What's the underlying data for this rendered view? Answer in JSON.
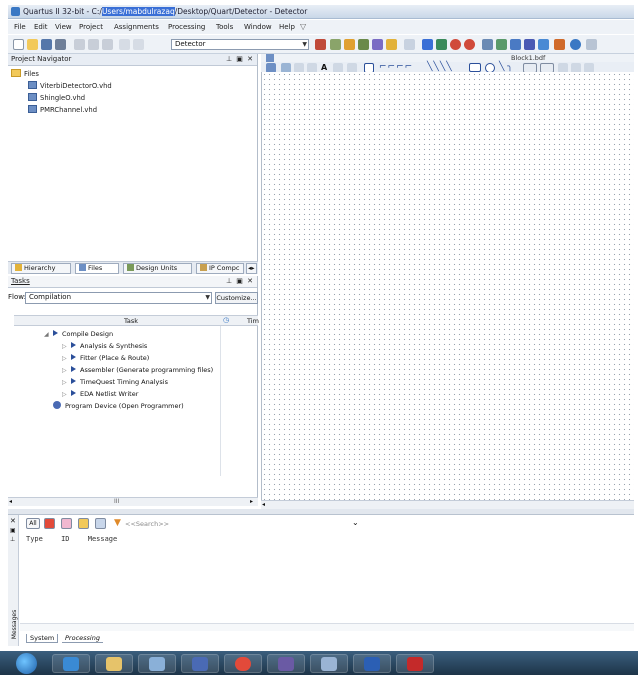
{
  "window": {
    "title_prefix": "Quartus II 32-bit - C:/",
    "title_user": "Users/mabdulrazaq",
    "title_suffix": "/Desktop/Quart/Detector - Detector"
  },
  "menu": [
    "File",
    "Edit",
    "View",
    "Project",
    "Assignments",
    "Processing",
    "Tools",
    "Window",
    "Help"
  ],
  "toolbar": {
    "entity_combo": "Detector"
  },
  "project_navigator": {
    "title": "Project Navigator",
    "root": "Files",
    "files": [
      "ViterbiDetectorO.vhd",
      "ShingleO.vhd",
      "PMRChannel.vhd"
    ],
    "tabs": [
      "Hierarchy",
      "Files",
      "Design Units",
      "IP Compc"
    ]
  },
  "document": {
    "tab_title": "Block1.bdf"
  },
  "tasks": {
    "title": "Tasks",
    "flow_label": "Flow:",
    "flow_value": "Compilation",
    "customize": "Customize...",
    "col_task": "Task",
    "col_time": "Tim",
    "rows": [
      "Compile Design",
      "Analysis & Synthesis",
      "Fitter (Place & Route)",
      "Assembler (Generate programming files)",
      "TimeQuest Timing Analysis",
      "EDA Netlist Writer",
      "Program Device (Open Programmer)"
    ],
    "scroll_mark": "III"
  },
  "messages": {
    "all_label": "All",
    "search_placeholder": "<<Search>>",
    "col_type": "Type",
    "col_id": "ID",
    "col_message": "Message",
    "side_label": "Messages",
    "tabs": [
      "System",
      "Processing"
    ]
  },
  "colors": {
    "titlebar": "#c9d7e8",
    "accent": "#2b4f9a",
    "taskbar": "#1d3448"
  }
}
